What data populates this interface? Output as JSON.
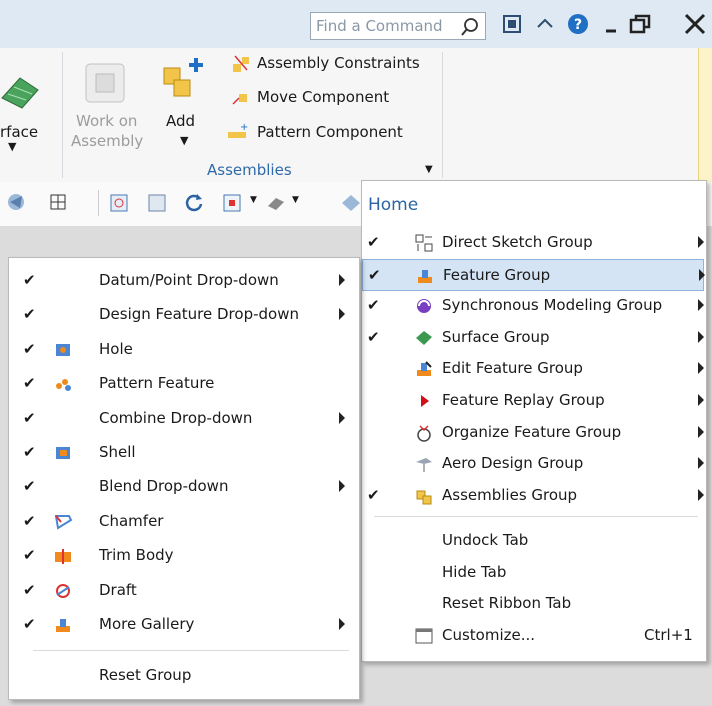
{
  "titlebar": {
    "find_placeholder": "Find a Command",
    "icons": [
      "search-icon",
      "window-icon",
      "collapse-ribbon-icon",
      "help-icon",
      "minimize-icon",
      "restore-icon",
      "close-icon"
    ]
  },
  "ribbon": {
    "surface_label": "rface",
    "work_on_assembly_line1": "Work on",
    "work_on_assembly_line2": "Assembly",
    "add_label": "Add",
    "assembly_constraints": "Assembly Constraints",
    "move_component": "Move Component",
    "pattern_component": "Pattern Component",
    "group_label": "Assemblies"
  },
  "home_menu": {
    "title": "Home",
    "items": [
      {
        "label": "Direct Sketch Group",
        "checked": true,
        "submenu": true
      },
      {
        "label": "Feature Group",
        "checked": true,
        "submenu": true,
        "highlighted": true
      },
      {
        "label": "Synchronous Modeling Group",
        "checked": true,
        "submenu": true
      },
      {
        "label": "Surface Group",
        "checked": true,
        "submenu": true
      },
      {
        "label": "Edit Feature Group",
        "checked": false,
        "submenu": true
      },
      {
        "label": "Feature Replay Group",
        "checked": false,
        "submenu": true
      },
      {
        "label": "Organize Feature Group",
        "checked": false,
        "submenu": true
      },
      {
        "label": "Aero Design Group",
        "checked": false,
        "submenu": true
      },
      {
        "label": "Assemblies Group",
        "checked": true,
        "submenu": true
      }
    ],
    "actions": [
      "Undock Tab",
      "Hide Tab",
      "Reset Ribbon Tab"
    ],
    "customize_label": "Customize...",
    "customize_shortcut": "Ctrl+1"
  },
  "feature_menu": {
    "items": [
      {
        "label": "Datum/Point Drop-down",
        "checked": true,
        "submenu": true
      },
      {
        "label": "Design Feature Drop-down",
        "checked": true,
        "submenu": true
      },
      {
        "label": "Hole",
        "checked": true,
        "submenu": false
      },
      {
        "label": "Pattern Feature",
        "checked": true,
        "submenu": false
      },
      {
        "label": "Combine Drop-down",
        "checked": true,
        "submenu": true
      },
      {
        "label": "Shell",
        "checked": true,
        "submenu": false
      },
      {
        "label": "Blend Drop-down",
        "checked": true,
        "submenu": true
      },
      {
        "label": "Chamfer",
        "checked": true,
        "submenu": false
      },
      {
        "label": "Trim Body",
        "checked": true,
        "submenu": false
      },
      {
        "label": "Draft",
        "checked": true,
        "submenu": false
      },
      {
        "label": "More Gallery",
        "checked": true,
        "submenu": true
      }
    ],
    "reset_label": "Reset Group"
  },
  "colors": {
    "accent": "#2b63a3",
    "highlight": "#d4e4f5",
    "highlight_border": "#8fb3dd",
    "check": "#1a1a1a"
  },
  "check_glyph": "✔"
}
